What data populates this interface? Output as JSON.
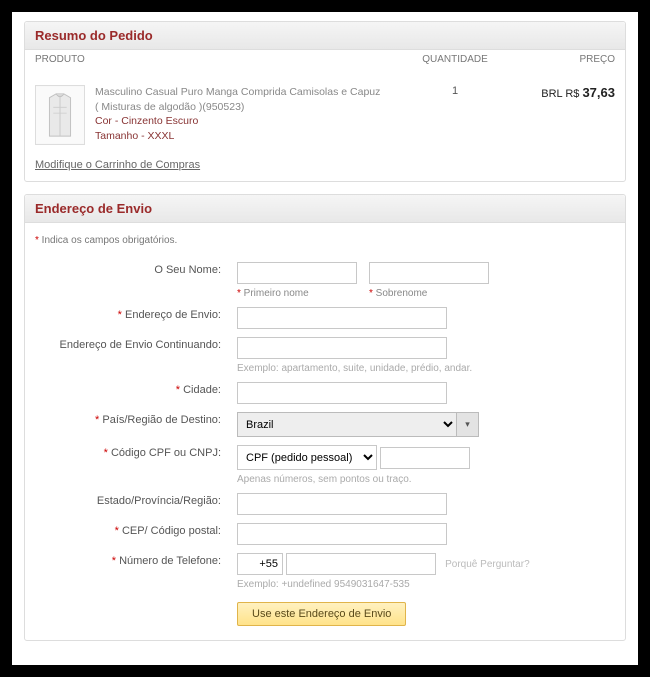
{
  "order": {
    "title": "Resumo do Pedido",
    "columns": {
      "product": "PRODUTO",
      "qty": "QUANTIDADE",
      "price": "PREÇO"
    },
    "item": {
      "name": "Masculino Casual Puro Manga Comprida Camisolas e Capuz ( Misturas de algodão )(950523)",
      "attr1_label": "Cor - ",
      "attr1_value": "Cinzento Escuro",
      "attr2_label": "Tamanho - ",
      "attr2_value": "XXXL",
      "qty": "1",
      "price_cur": "BRL R$ ",
      "price_amt": "37,63"
    },
    "modify": "Modifique o Carrinho de Compras"
  },
  "ship": {
    "title": "Endereço de Envio",
    "required_hint": "Indica os campos obrigatórios.",
    "name_label": "O Seu Nome:",
    "first_name": "Primeiro nome",
    "last_name": "Sobrenome",
    "addr1": "Endereço de Envio:",
    "addr2": "Endereço de Envio Continuando:",
    "addr_hint": "Exemplo: apartamento, suite, unidade, prédio, andar.",
    "city": "Cidade:",
    "country": "País/Região de Destino:",
    "country_value": "Brazil",
    "cpf": "Código CPF ou CNPJ:",
    "cpf_options": [
      "CPF (pedido pessoal)"
    ],
    "cpf_hint": "Apenas números, sem pontos ou traço.",
    "state": "Estado/Província/Região:",
    "zip": "CEP/ Código postal:",
    "phone": "Número de Telefone:",
    "phone_cc": "+55",
    "phone_ask": "Porquê Perguntar?",
    "phone_hint": "Exemplo: +undefined 9549031647-535",
    "submit": "Use este Endereço de Envio"
  }
}
